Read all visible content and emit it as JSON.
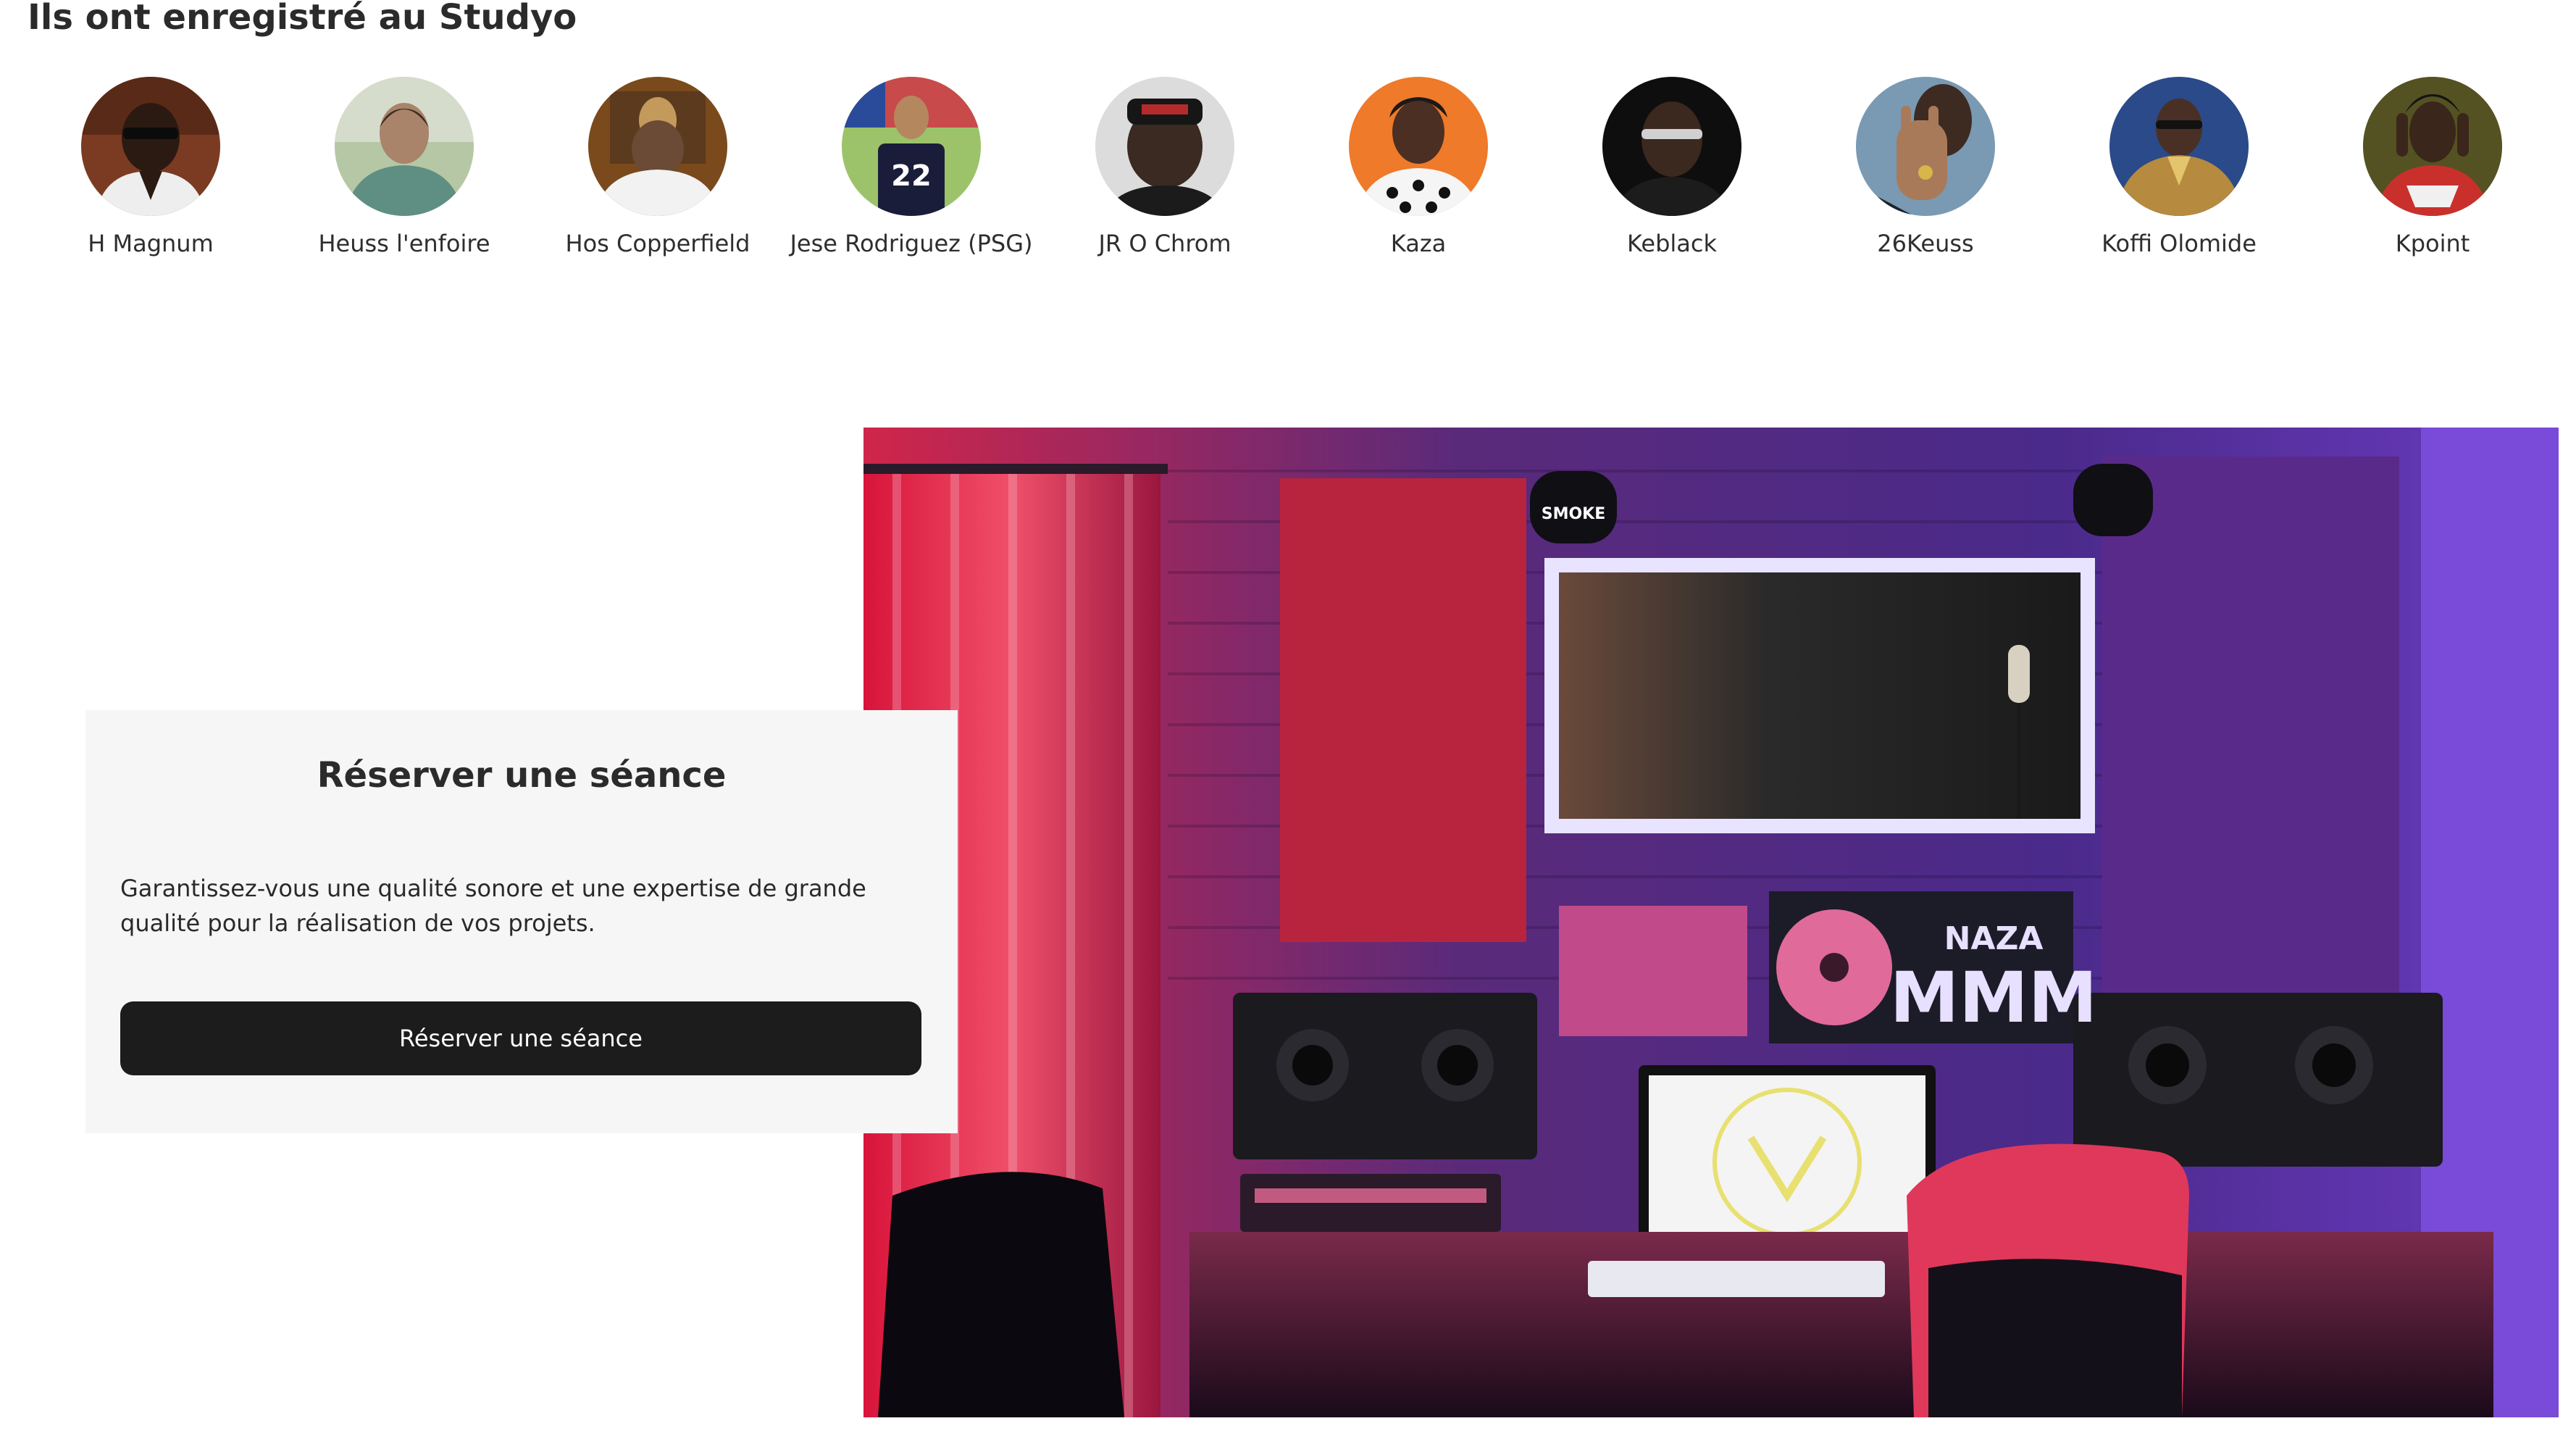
{
  "section": {
    "title": "Ils ont enregistré au Studyo"
  },
  "artists": [
    {
      "name": "H Magnum"
    },
    {
      "name": "Heuss l'enfoire"
    },
    {
      "name": "Hos Copperfield"
    },
    {
      "name": "Jese Rodriguez (PSG)"
    },
    {
      "name": "JR O Chrom"
    },
    {
      "name": "Kaza"
    },
    {
      "name": "Keblack"
    },
    {
      "name": "26Keuss"
    },
    {
      "name": "Koffi Olomide"
    },
    {
      "name": "Kpoint"
    }
  ],
  "booking": {
    "title": "Réserver une séance",
    "description": "Garantissez-vous une qualité sonore et une expertise de grande qualité pour la réalisation de vos projets.",
    "button_label": "Réserver une séance"
  },
  "studio_photo": {
    "wall_text_1": "NAZA",
    "wall_text_2": "MMM",
    "cap_text": "SMOKE"
  },
  "colors": {
    "card_background": "#f6f6f6",
    "button_background": "#1c1c1c",
    "button_text": "#ffffff",
    "heading_text": "#2b2b2b"
  }
}
